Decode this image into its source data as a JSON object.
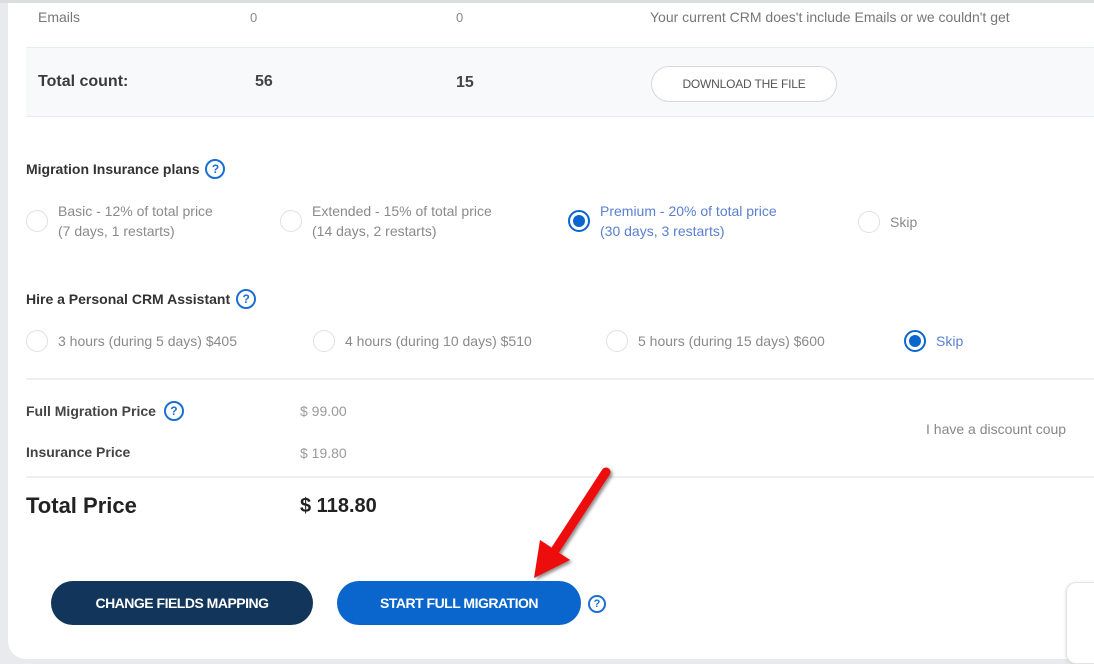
{
  "counts_table": {
    "rows": [
      {
        "label": "Emails",
        "value_1": "0",
        "value_2": "0",
        "note": "Your current CRM does't include Emails or we couldn't get"
      }
    ],
    "total": {
      "label": "Total count:",
      "value_1": "56",
      "value_2": "15",
      "download_label": "DOWNLOAD THE FILE"
    }
  },
  "insurance": {
    "title": "Migration Insurance plans",
    "help_icon": "question-circle-icon",
    "options": [
      {
        "line1": "Basic - 12% of total price",
        "line2": "(7 days, 1 restarts)",
        "selected": false
      },
      {
        "line1": "Extended - 15% of total price",
        "line2": "(14 days, 2 restarts)",
        "selected": false
      },
      {
        "line1": "Premium - 20% of total price",
        "line2": "(30 days, 3 restarts)",
        "selected": true
      },
      {
        "line1": "Skip",
        "line2": "",
        "selected": false
      }
    ]
  },
  "assistant": {
    "title": "Hire a Personal CRM Assistant",
    "help_icon": "question-circle-icon",
    "options": [
      {
        "label": "3 hours (during 5 days) $405",
        "selected": false
      },
      {
        "label": "4 hours (during 10 days) $510",
        "selected": false
      },
      {
        "label": "5 hours (during 15 days) $600",
        "selected": false
      },
      {
        "label": "Skip",
        "selected": true
      }
    ]
  },
  "pricing": {
    "full_migration_label": "Full Migration Price",
    "full_migration_value": "$ 99.00",
    "insurance_label": "Insurance Price",
    "insurance_value": "$ 19.80",
    "total_label": "Total Price",
    "total_value": "$ 118.80",
    "coupon_link": "I have a discount coup"
  },
  "actions": {
    "change_mapping_label": "CHANGE FIELDS MAPPING",
    "start_migration_label": "START FULL MIGRATION",
    "help_icon": "question-circle-icon"
  },
  "annotation": {
    "arrow_color": "#ee1111",
    "arrow_target": "start-full-migration-button"
  },
  "colors": {
    "primary_blue": "#0a66cc",
    "dark_navy": "#12355b",
    "selected_text": "#5a7fd0"
  }
}
